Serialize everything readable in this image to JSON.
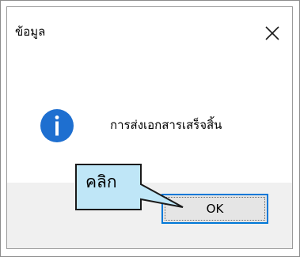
{
  "dialog": {
    "title": "ข้อมูล",
    "message": "การส่งเอกสารเสร็จสิ้น",
    "ok_label": "OK",
    "icons": {
      "close": "close-icon",
      "info": "info-icon"
    }
  },
  "annotation": {
    "label": "คลิก"
  },
  "colors": {
    "info_icon": "#1e6fd0",
    "ok_focus_border": "#0078d7",
    "footer_background": "#f0f0f0",
    "callout_fill": "#bfe6f7"
  }
}
